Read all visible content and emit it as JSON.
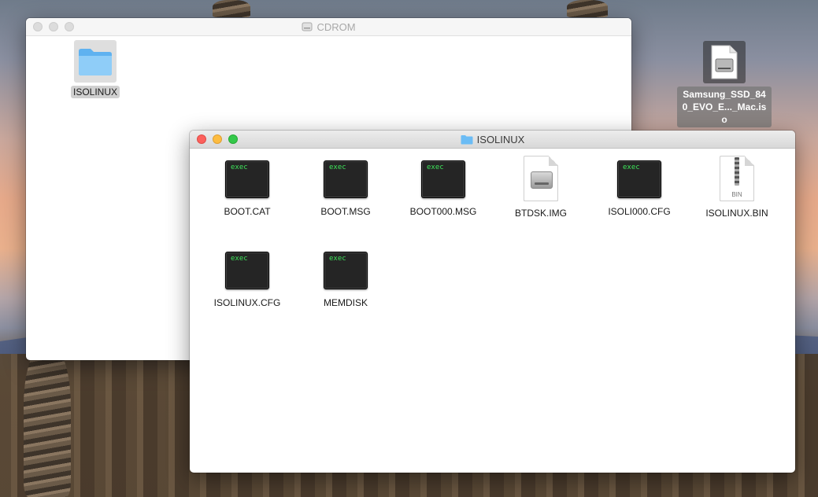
{
  "desktop": {
    "icon_label": "Samsung_SSD_840_EVO_E..._Mac.iso"
  },
  "cdrom_window": {
    "title": "CDROM",
    "items": [
      {
        "label": "ISOLINUX",
        "kind": "folder"
      }
    ]
  },
  "isolinux_window": {
    "title": "ISOLINUX",
    "items": [
      {
        "label": "BOOT.CAT",
        "kind": "exec",
        "badge": "exec"
      },
      {
        "label": "BOOT.MSG",
        "kind": "exec",
        "badge": "exec"
      },
      {
        "label": "BOOT000.MSG",
        "kind": "exec",
        "badge": "exec"
      },
      {
        "label": "BTDSK.IMG",
        "kind": "disk-image"
      },
      {
        "label": "ISOLI000.CFG",
        "kind": "exec",
        "badge": "exec"
      },
      {
        "label": "ISOLINUX.BIN",
        "kind": "document",
        "badge": "BIN"
      },
      {
        "label": "ISOLINUX.CFG",
        "kind": "exec",
        "badge": "exec"
      },
      {
        "label": "MEMDISK",
        "kind": "exec",
        "badge": "exec"
      }
    ]
  },
  "colors": {
    "close": "#fc605c",
    "minimize": "#fdbc40",
    "maximize": "#34c84a",
    "folder": "#6bbcf5",
    "terminal_text": "#3ee35a"
  }
}
